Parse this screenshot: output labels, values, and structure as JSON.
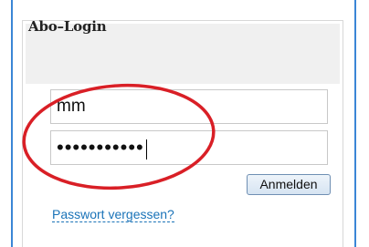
{
  "login_box": {
    "title": "Abo–Login",
    "username_value": "mm",
    "password_value": "•••••••••••",
    "login_button_label": "Anmelden",
    "forgot_password_link": "Passwort vergessen?"
  },
  "colors": {
    "frame_border": "#3b86d6",
    "annotation_ellipse": "#d91f26",
    "link": "#1a73b8"
  }
}
